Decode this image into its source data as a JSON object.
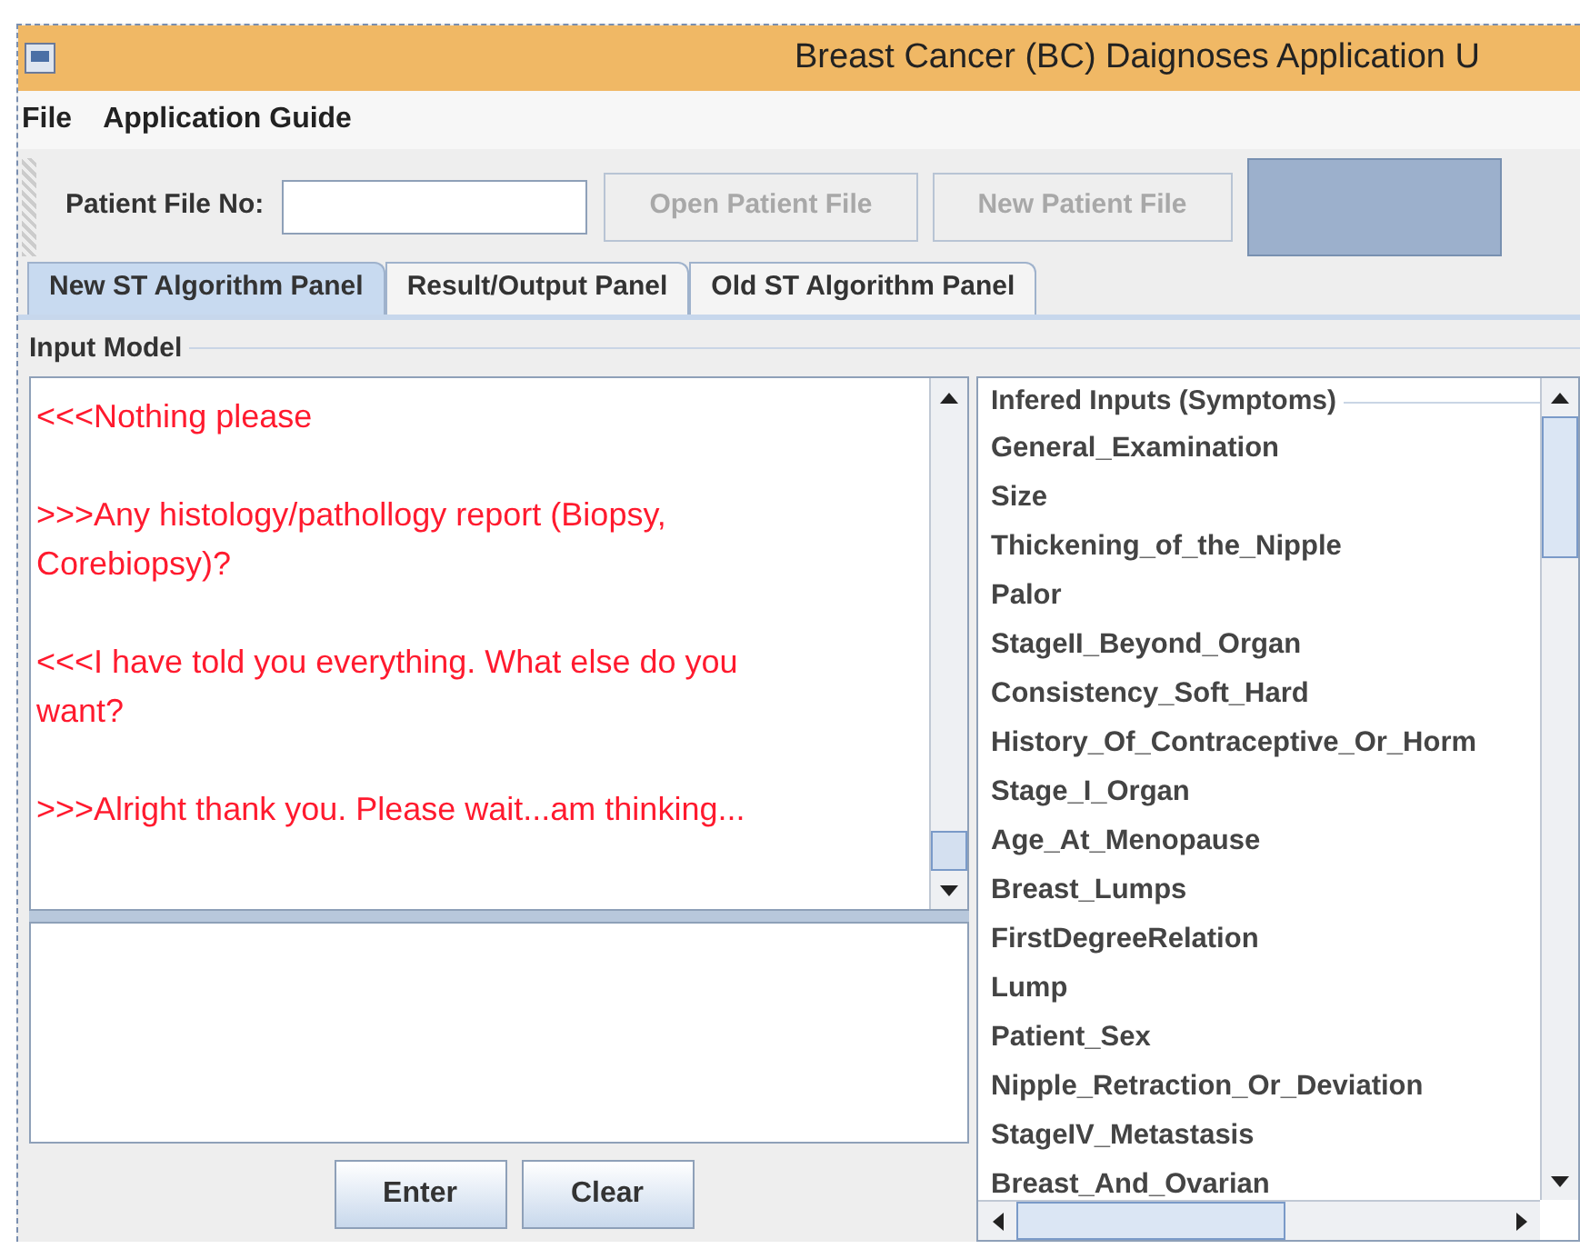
{
  "window": {
    "title": "Breast Cancer (BC) Daignoses Application U"
  },
  "menu": [
    "File",
    "Application Guide"
  ],
  "toolbar": {
    "label": "Patient File No:",
    "buttons": [
      {
        "label": "Open Patient File",
        "disabled": true
      },
      {
        "label": "New Patient File",
        "disabled": true
      }
    ]
  },
  "tabs": [
    {
      "label": "New ST Algorithm Panel",
      "selected": true
    },
    {
      "label": "Result/Output Panel",
      "selected": false
    },
    {
      "label": "Old ST Algorithm Panel",
      "selected": false
    }
  ],
  "input_model": {
    "title": "Input Model",
    "messages": [
      "<<<Nothing please",
      ">>>Any histology/pathollogy report (Biopsy, Corebiopsy)?",
      "<<<I have told you everything. What else do you want?",
      ">>>Alright thank you. Please wait...am thinking..."
    ],
    "buttons": [
      "Enter",
      "Clear"
    ]
  },
  "inferred_inputs": {
    "title": "Infered Inputs (Symptoms)",
    "items": [
      "General_Examination",
      "Size",
      "Thickening_of_the_Nipple",
      "Palor",
      "StageII_Beyond_Organ",
      "Consistency_Soft_Hard",
      "History_Of_Contraceptive_Or_Horm",
      "Stage_I_Organ",
      "Age_At_Menopause",
      "Breast_Lumps",
      "FirstDegreeRelation",
      "Lump",
      "Patient_Sex",
      "Nipple_Retraction_Or_Deviation",
      "StageIV_Metastasis",
      "Breast_And_Ovarian"
    ]
  }
}
